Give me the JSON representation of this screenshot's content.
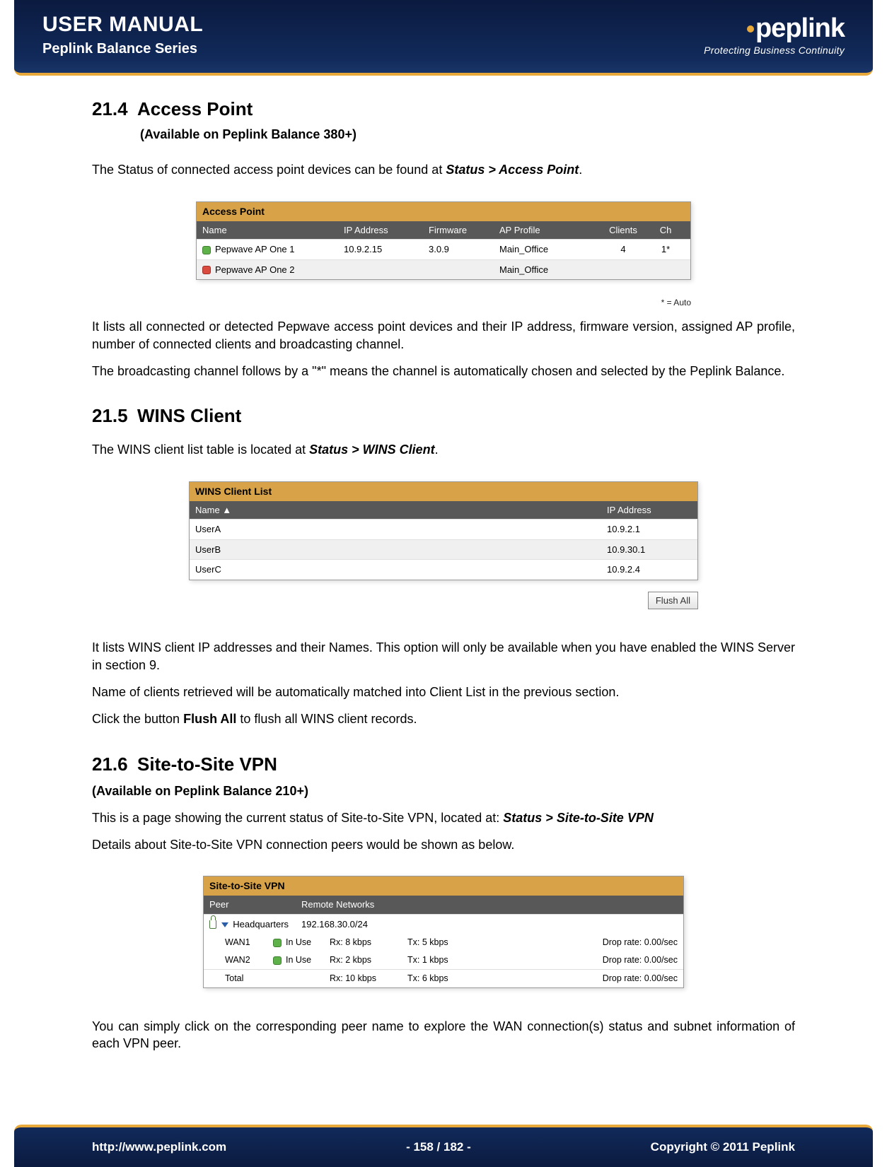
{
  "header": {
    "title": "USER MANUAL",
    "subtitle": "Peplink Balance Series",
    "brand": "peplink",
    "tagline": "Protecting Business Continuity"
  },
  "sections": {
    "s1": {
      "num": "21.4",
      "title": "Access Point",
      "sub": "(Available on Peplink Balance 380+)",
      "intro_pre": "The Status of connected access point devices can be found at ",
      "intro_em": "Status > Access Point",
      "intro_post": ".",
      "p2": "It lists all connected or detected Pepwave access point devices and their IP address, firmware version, assigned AP profile, number of connected clients and broadcasting channel.",
      "p3": "The broadcasting channel follows by a \"*\" means the channel is automatically chosen and selected by the Peplink Balance."
    },
    "s2": {
      "num": "21.5",
      "title": "WINS Client",
      "intro_pre": "The WINS client list table is located at ",
      "intro_em": "Status > WINS Client",
      "intro_post": ".",
      "p2": "It lists WINS client IP addresses and their Names. This option will only be available when you have enabled the WINS Server in section 9.",
      "p3": "Name of clients retrieved will be automatically matched into Client List in the previous section.",
      "p4_pre": "Click the button ",
      "p4_b": "Flush All",
      "p4_post": " to flush all WINS client records."
    },
    "s3": {
      "num": "21.6",
      "title": "Site-to-Site VPN",
      "sub": "(Available on Peplink Balance 210+)",
      "p1_pre": "This is a page showing the current status of Site-to-Site VPN, located at: ",
      "p1_em": "Status > Site-to-Site VPN",
      "p2": "Details about Site-to-Site VPN connection peers would be shown as below.",
      "p3": "You can simply click on the corresponding peer name to explore the WAN connection(s) status and subnet information of each VPN peer."
    }
  },
  "ap_table": {
    "panel": "Access Point",
    "headers": {
      "name": "Name",
      "ip": "IP Address",
      "fw": "Firmware",
      "prof": "AP Profile",
      "cli": "Clients",
      "ch": "Ch"
    },
    "rows": [
      {
        "status": "up",
        "name": "Pepwave AP One 1",
        "ip": "10.9.2.15",
        "fw": "3.0.9",
        "prof": "Main_Office",
        "cli": "4",
        "ch": "1*"
      },
      {
        "status": "down",
        "name": "Pepwave AP One 2",
        "ip": "",
        "fw": "",
        "prof": "Main_Office",
        "cli": "",
        "ch": ""
      }
    ],
    "note": "* = Auto"
  },
  "wins_table": {
    "panel": "WINS Client List",
    "headers": {
      "name": "Name  ▲",
      "ip": "IP Address"
    },
    "rows": [
      {
        "name": "UserA",
        "ip": "10.9.2.1"
      },
      {
        "name": "UserB",
        "ip": "10.9.30.1"
      },
      {
        "name": "UserC",
        "ip": "10.9.2.4"
      }
    ],
    "flush": "Flush All"
  },
  "vpn_table": {
    "panel": "Site-to-Site VPN",
    "headers": {
      "peer": "Peer",
      "net": "Remote Networks"
    },
    "peer": {
      "name": "Headquarters",
      "net": "192.168.30.0/24"
    },
    "wan_rows": [
      {
        "wan": "WAN1",
        "status": "In Use",
        "rx": "Rx:   8 kbps",
        "tx": "Tx:   5 kbps",
        "drop": "Drop rate:   0.00/sec"
      },
      {
        "wan": "WAN2",
        "status": "In Use",
        "rx": "Rx:   2 kbps",
        "tx": "Tx:   1 kbps",
        "drop": "Drop rate:   0.00/sec"
      }
    ],
    "total": {
      "wan": "Total",
      "status": "",
      "rx": "Rx:   10 kbps",
      "tx": "Tx:   6 kbps",
      "drop": "Drop rate:   0.00/sec"
    }
  },
  "footer": {
    "url": "http://www.peplink.com",
    "page": "- 158 / 182 -",
    "copyright": "Copyright © 2011 Peplink"
  }
}
